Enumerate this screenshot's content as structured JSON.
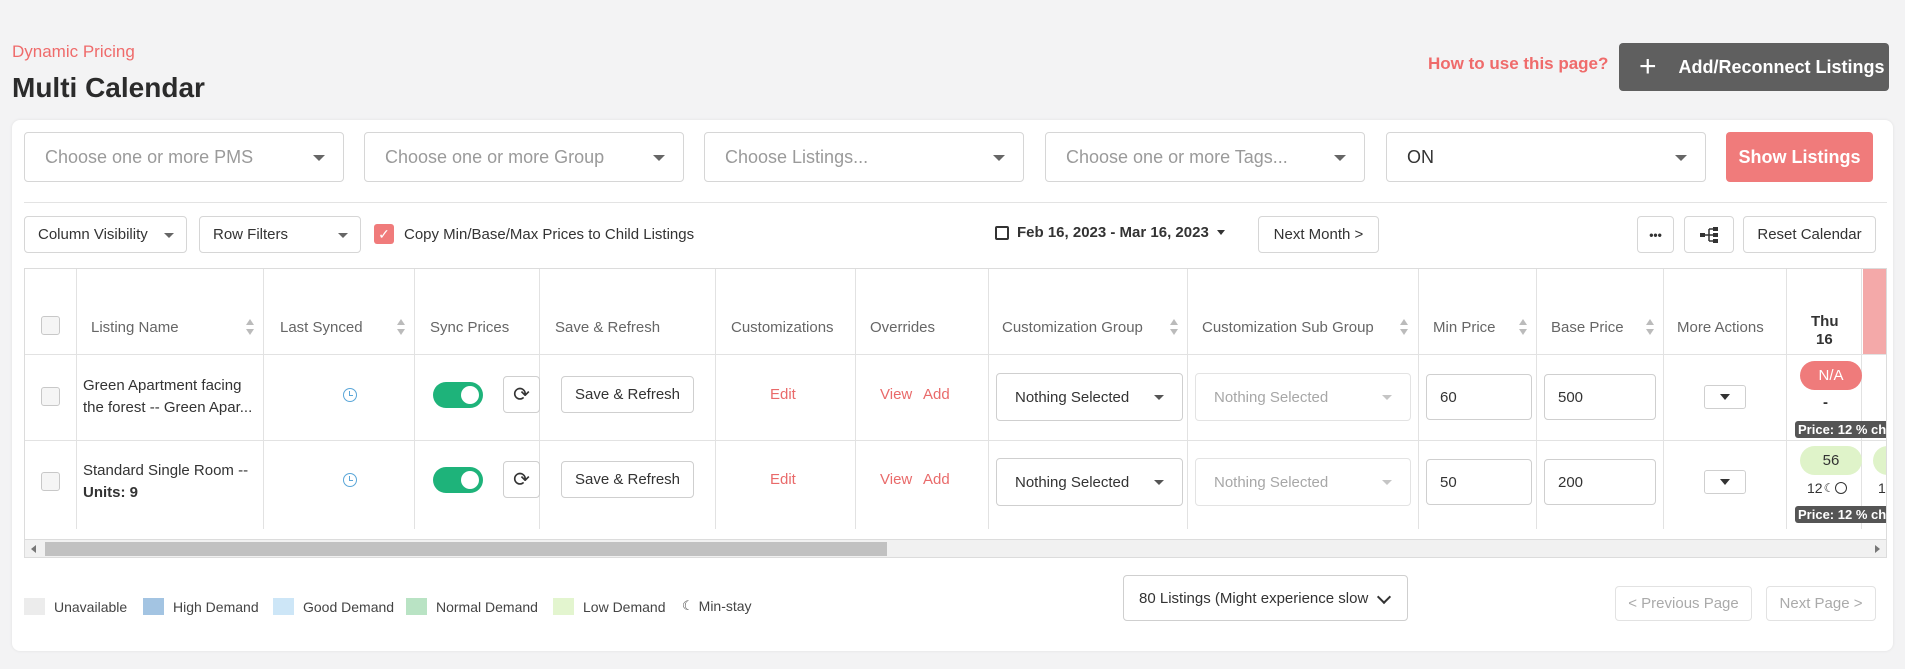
{
  "header": {
    "breadcrumb": "Dynamic Pricing",
    "title": "Multi Calendar",
    "help_link": "How to use this page?",
    "add_button": "Add/Reconnect Listings"
  },
  "filters": {
    "pms_placeholder": "Choose one or more PMS",
    "group_placeholder": "Choose one or more Group",
    "listings_placeholder": "Choose Listings...",
    "tags_placeholder": "Choose one or more Tags...",
    "status_value": "ON",
    "show_button": "Show Listings"
  },
  "toolbar": {
    "column_visibility": "Column Visibility",
    "row_filters": "Row Filters",
    "copy_checkbox_label": "Copy Min/Base/Max Prices to Child Listings",
    "copy_checked": true,
    "date_range": "Feb 16, 2023 - Mar 16, 2023",
    "next_month": "Next Month >",
    "more_label": "•••",
    "reset_calendar": "Reset Calendar"
  },
  "table": {
    "columns": [
      "Listing Name",
      "Last Synced",
      "Sync Prices",
      "Save & Refresh",
      "Customizations",
      "Overrides",
      "Customization Group",
      "Customization Sub Group",
      "Min Price",
      "Base Price",
      "More Actions"
    ],
    "date_column": {
      "day": "Thu",
      "date": "16"
    },
    "rows": [
      {
        "name_line1": "Green Apartment facing",
        "name_line2": "the forest -- Green Apar...",
        "save_refresh": "Save & Refresh",
        "customization": "Edit",
        "override_view": "View",
        "override_add": "Add",
        "group": "Nothing Selected",
        "sub_group": "Nothing Selected",
        "min_price": "60",
        "base_price": "500",
        "date_cell": "N/A",
        "date_sub": "-",
        "price_tag": "Price: 12 % ch"
      },
      {
        "name_line1": "Standard Single Room --",
        "name_line2": "Units: 9",
        "save_refresh": "Save & Refresh",
        "customization": "Edit",
        "override_view": "View",
        "override_add": "Add",
        "group": "Nothing Selected",
        "sub_group": "Nothing Selected",
        "min_price": "50",
        "base_price": "200",
        "date_cell": "56",
        "date_sub": "12",
        "next_cell_partial": "1",
        "price_tag": "Price: 12 % ch"
      }
    ]
  },
  "legend": [
    {
      "label": "Unavailable",
      "color": "#ececec"
    },
    {
      "label": "High Demand",
      "color": "#a3c4e2"
    },
    {
      "label": "Good Demand",
      "color": "#cde6f7"
    },
    {
      "label": "Normal Demand",
      "color": "#b9e3c4"
    },
    {
      "label": "Low Demand",
      "color": "#e3f5cf"
    },
    {
      "label": "Min-stay",
      "icon": "moon-icon"
    }
  ],
  "footer": {
    "listings_count": "80 Listings (Might experience slow",
    "prev_page": "< Previous Page",
    "next_page": "Next Page >"
  },
  "colors": {
    "accent": "#ef6b6b",
    "toggle_on": "#1eb37a",
    "na_pill": "#ef7b7b",
    "low_demand_pill": "#dff3c9"
  }
}
